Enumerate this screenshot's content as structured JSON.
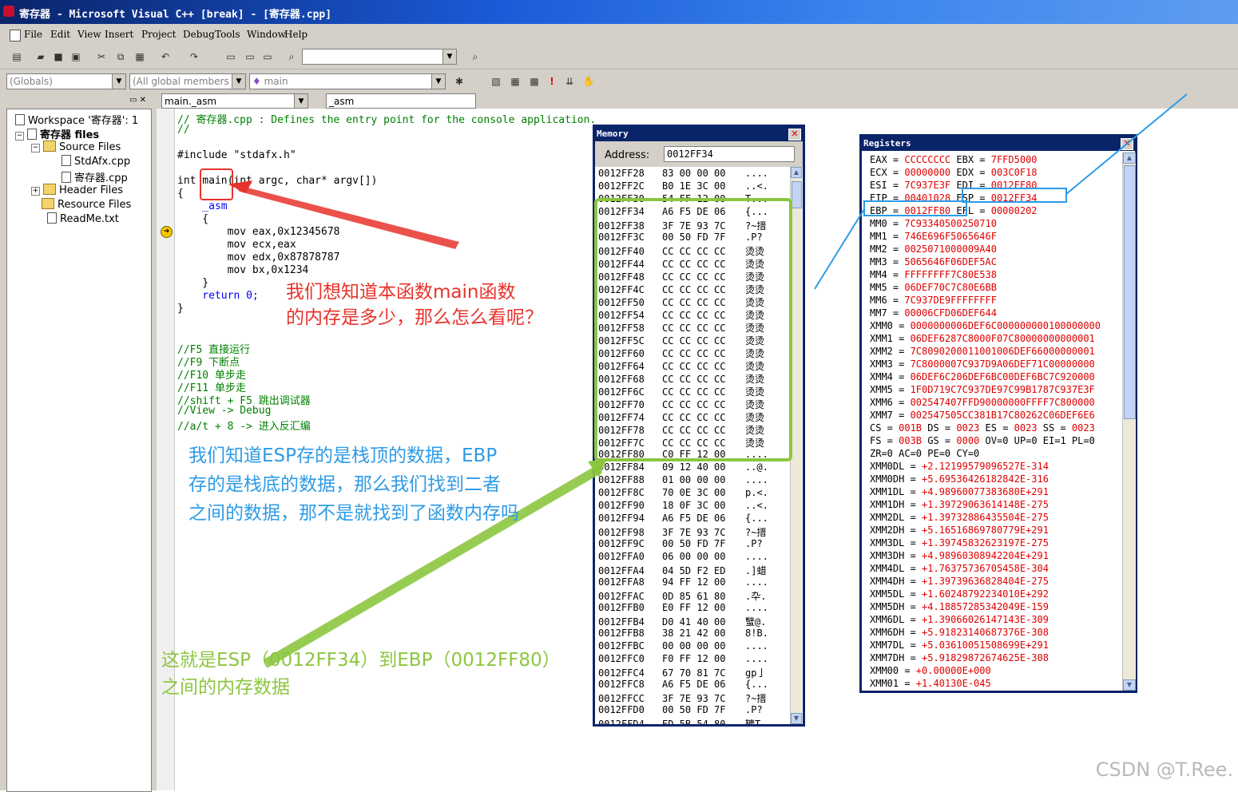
{
  "window": {
    "title": "寄存器 - Microsoft Visual C++ [break] - [寄存器.cpp]"
  },
  "menu": [
    "File",
    "Edit",
    "View",
    "Insert",
    "Project",
    "Debug",
    "Tools",
    "Window",
    "Help"
  ],
  "toolbar2": {
    "globals": "(Globals)",
    "members": "(All global members",
    "func": "main"
  },
  "workspace": {
    "root": "Workspace '寄存器': 1",
    "project": "寄存器 files",
    "source_folder": "Source Files",
    "files": [
      "StdAfx.cpp",
      "寄存器.cpp"
    ],
    "header_folder": "Header Files",
    "resource_folder": "Resource Files",
    "readme": "ReadMe.txt"
  },
  "editor": {
    "combo_left": "main._asm",
    "combo_right": "_asm",
    "lines": [
      "// 寄存器.cpp : Defines the entry point for the console application.",
      "//",
      "",
      "#include \"stdafx.h\"",
      "",
      "int main(int argc, char* argv[])",
      "{",
      "    _asm",
      "    {",
      "        mov eax,0x12345678",
      "        mov ecx,eax",
      "        mov edx,0x87878787",
      "        mov bx,0x1234",
      "    }",
      "    return 0;",
      "}",
      "",
      "//F5 直接运行",
      "//F9 下断点",
      "//F10 单步走",
      "//F11 单步走",
      "//shift + F5 跳出调试器",
      "//View -> Debug",
      "//a/t + 8 -> 进入反汇编"
    ]
  },
  "memory": {
    "title": "Memory",
    "address_label": "Address:",
    "address_value": "0012FF34",
    "rows": [
      [
        "0012FF28",
        "83 00 00 00",
        "...."
      ],
      [
        "0012FF2C",
        "B0 1E 3C 00",
        "..<."
      ],
      [
        "0012FF30",
        "54 FF 12 00",
        "T..."
      ],
      [
        "0012FF34",
        "A6 F5 DE 06",
        "{..."
      ],
      [
        "0012FF38",
        "3F 7E 93 7C",
        "?~搢"
      ],
      [
        "0012FF3C",
        "00 50 FD 7F",
        ".P?"
      ],
      [
        "0012FF40",
        "CC CC CC CC",
        "烫烫"
      ],
      [
        "0012FF44",
        "CC CC CC CC",
        "烫烫"
      ],
      [
        "0012FF48",
        "CC CC CC CC",
        "烫烫"
      ],
      [
        "0012FF4C",
        "CC CC CC CC",
        "烫烫"
      ],
      [
        "0012FF50",
        "CC CC CC CC",
        "烫烫"
      ],
      [
        "0012FF54",
        "CC CC CC CC",
        "烫烫"
      ],
      [
        "0012FF58",
        "CC CC CC CC",
        "烫烫"
      ],
      [
        "0012FF5C",
        "CC CC CC CC",
        "烫烫"
      ],
      [
        "0012FF60",
        "CC CC CC CC",
        "烫烫"
      ],
      [
        "0012FF64",
        "CC CC CC CC",
        "烫烫"
      ],
      [
        "0012FF68",
        "CC CC CC CC",
        "烫烫"
      ],
      [
        "0012FF6C",
        "CC CC CC CC",
        "烫烫"
      ],
      [
        "0012FF70",
        "CC CC CC CC",
        "烫烫"
      ],
      [
        "0012FF74",
        "CC CC CC CC",
        "烫烫"
      ],
      [
        "0012FF78",
        "CC CC CC CC",
        "烫烫"
      ],
      [
        "0012FF7C",
        "CC CC CC CC",
        "烫烫"
      ],
      [
        "0012FF80",
        "C0 FF 12 00",
        "...."
      ],
      [
        "0012FF84",
        "09 12 40 00",
        "..@."
      ],
      [
        "0012FF88",
        "01 00 00 00",
        "...."
      ],
      [
        "0012FF8C",
        "70 0E 3C 00",
        "p.<."
      ],
      [
        "0012FF90",
        "18 0F 3C 00",
        "..<."
      ],
      [
        "0012FF94",
        "A6 F5 DE 06",
        "{..."
      ],
      [
        "0012FF98",
        "3F 7E 93 7C",
        "?~搢"
      ],
      [
        "0012FF9C",
        "00 50 FD 7F",
        ".P?"
      ],
      [
        "0012FFA0",
        "06 00 00 00",
        "...."
      ],
      [
        "0012FFA4",
        "04 5D F2 ED",
        ".]蜡"
      ],
      [
        "0012FFA8",
        "94 FF 12 00",
        "...."
      ],
      [
        "0012FFAC",
        "0D 85 61 80",
        ".卆."
      ],
      [
        "0012FFB0",
        "E0 FF 12 00",
        "...."
      ],
      [
        "0012FFB4",
        "D0 41 40 00",
        "蠥@."
      ],
      [
        "0012FFB8",
        "38 21 42 00",
        "8!B."
      ],
      [
        "0012FFBC",
        "00 00 00 00",
        "...."
      ],
      [
        "0012FFC0",
        "F0 FF 12 00",
        "...."
      ],
      [
        "0012FFC4",
        "67 70 81 7C",
        "gp亅"
      ],
      [
        "0012FFC8",
        "A6 F5 DE 06",
        "{..."
      ],
      [
        "0012FFCC",
        "3F 7E 93 7C",
        "?~搢"
      ],
      [
        "0012FFD0",
        "00 50 FD 7F",
        ".P?"
      ],
      [
        "0012FFD4",
        "ED 5B 54 80",
        "韀T."
      ]
    ]
  },
  "registers": {
    "title": "Registers",
    "rows": [
      [
        [
          "EAX = ",
          "CCCCCCCC"
        ],
        [
          " EBX = ",
          "7FFD5000"
        ]
      ],
      [
        [
          "ECX = ",
          "00000000"
        ],
        [
          " EDX = ",
          "003C0F18"
        ]
      ],
      [
        [
          "ESI = ",
          "7C937E3F"
        ],
        [
          " EDI = ",
          "0012FF80"
        ]
      ],
      [
        [
          "EIP = ",
          "00401028"
        ],
        [
          " ESP = ",
          "0012FF34"
        ]
      ],
      [
        [
          "EBP = ",
          "0012FF80"
        ],
        [
          " EFL = ",
          "00000202"
        ]
      ],
      [
        [
          "MM0 = ",
          "7C93340500250710"
        ]
      ],
      [
        [
          "MM1 = ",
          "746E696F5065646F"
        ]
      ],
      [
        [
          "MM2 = ",
          "0025071000009A40"
        ]
      ],
      [
        [
          "MM3 = ",
          "5065646F06DEF5AC"
        ]
      ],
      [
        [
          "MM4 = ",
          "FFFFFFFF7C80E538"
        ]
      ],
      [
        [
          "MM5 = ",
          "06DEF70C7C80E6BB"
        ]
      ],
      [
        [
          "MM6 = ",
          "7C937DE9FFFFFFFF"
        ]
      ],
      [
        [
          "MM7 = ",
          "00006CFD06DEF644"
        ]
      ],
      [
        [
          "XMM0 = ",
          "0000000006DEF6C000000000100000000"
        ]
      ],
      [
        [
          "XMM1 = ",
          "06DEF6287C8000F07C80000000000001"
        ]
      ],
      [
        [
          "XMM2 = ",
          "7C8090200011001006DEF66000000001"
        ]
      ],
      [
        [
          "XMM3 = ",
          "7C8000007C937D9A06DEF71C00000000"
        ]
      ],
      [
        [
          "XMM4 = ",
          "06DEF6C206DEF6BC00DEF6BC7C920000"
        ]
      ],
      [
        [
          "XMM5 = ",
          "1F0D719C7C937DE97C99B1787C937E3F"
        ]
      ],
      [
        [
          "XMM6 = ",
          "002547407FFD90000000FFFF7C800000"
        ]
      ],
      [
        [
          "XMM7 = ",
          "002547505CC381B17C80262C06DEF6E6"
        ]
      ],
      [
        [
          "CS = ",
          "001B"
        ],
        [
          " DS = ",
          "0023"
        ],
        [
          " ES = ",
          "0023"
        ],
        [
          " SS = ",
          "0023"
        ]
      ],
      [
        [
          "FS = ",
          "003B"
        ],
        [
          " GS = ",
          "0000"
        ],
        [
          " OV=0 UP=0 EI=1 PL=0",
          ""
        ]
      ],
      [
        [
          "ZR=0 AC=0 PE=0 CY=0",
          ""
        ]
      ],
      [
        [
          "XMM0DL = ",
          "+2.12199579096527E-314"
        ]
      ],
      [
        [
          "XMM0DH = ",
          "+5.69536426182842E-316"
        ]
      ],
      [
        [
          "XMM1DL = ",
          "+4.98960077383680E+291"
        ]
      ],
      [
        [
          "XMM1DH = ",
          "+1.39729063614148E-275"
        ]
      ],
      [
        [
          "XMM2DL = ",
          "+1.39732886435504E-275"
        ]
      ],
      [
        [
          "XMM2DH = ",
          "+5.16516869780779E+291"
        ]
      ],
      [
        [
          "XMM3DL = ",
          "+1.39745832623197E-275"
        ]
      ],
      [
        [
          "XMM3DH = ",
          "+4.98960308942204E+291"
        ]
      ],
      [
        [
          "XMM4DL = ",
          "+1.76375736705458E-304"
        ]
      ],
      [
        [
          "XMM4DH = ",
          "+1.39739636828404E-275"
        ]
      ],
      [
        [
          "XMM5DL = ",
          "+1.60248792234010E+292"
        ]
      ],
      [
        [
          "XMM5DH = ",
          "+4.18857285342049E-159"
        ]
      ],
      [
        [
          "XMM6DL = ",
          "+1.39066026147143E-309"
        ]
      ],
      [
        [
          "XMM6DH = ",
          "+5.91823140687376E-308"
        ]
      ],
      [
        [
          "XMM7DL = ",
          "+5.03610051508699E+291"
        ]
      ],
      [
        [
          "XMM7DH = ",
          "+5.91829872674625E-308"
        ]
      ],
      [
        [
          "XMM00 = ",
          "+0.00000E+000"
        ]
      ],
      [
        [
          "XMM01 = ",
          "+1.40130E-045"
        ]
      ]
    ]
  },
  "annotations": {
    "red": [
      "我们想知道本函数main函数",
      "的内存是多少，那么怎么看呢？"
    ],
    "blue": [
      "我们知道ESP存的是栈顶的数据，EBP",
      "存的是栈底的数据，那么我们找到二者",
      "之间的数据，那不是就找到了函数内存吗"
    ],
    "green": [
      "这就是ESP（0012FF34）到EBP（0012FF80）",
      "之间的内存数据"
    ]
  },
  "watermark": "CSDN @T.Ree."
}
